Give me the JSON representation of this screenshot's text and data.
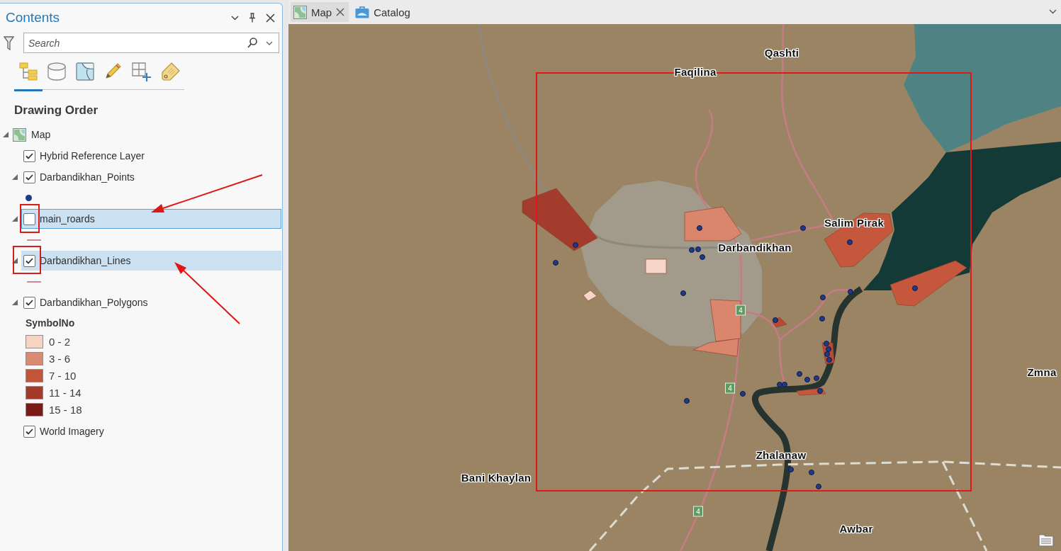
{
  "contents_pane": {
    "title": "Contents",
    "search": {
      "placeholder": "Search"
    },
    "views": [
      {
        "kind": "drawing-order",
        "selected": true
      },
      {
        "kind": "source",
        "selected": false
      },
      {
        "kind": "selection",
        "selected": false
      },
      {
        "kind": "editing",
        "selected": false
      },
      {
        "kind": "snapping",
        "selected": false
      },
      {
        "kind": "labeling",
        "selected": false
      }
    ],
    "heading": "Drawing Order",
    "tree": [
      {
        "label": "Map",
        "kind": "map",
        "expanded": true,
        "children": [
          {
            "label": "Hybrid Reference Layer",
            "checked": true,
            "selected": false,
            "focused": false
          },
          {
            "label": "Darbandikhan_Points",
            "checked": true,
            "selected": false,
            "focused": false,
            "expanded": true,
            "symbol": {
              "kind": "point",
              "color": "#1f3a8a"
            }
          },
          {
            "label": "main_roards",
            "checked": false,
            "selected": true,
            "focused": true,
            "expanded": true,
            "symbol": {
              "kind": "line",
              "color": "#c98a98"
            }
          },
          {
            "label": "Darbandikhan_Lines",
            "checked": true,
            "selected": true,
            "focused": false,
            "expanded": true,
            "symbol": {
              "kind": "line",
              "color": "#c98a98"
            }
          },
          {
            "label": "Darbandikhan_Polygons",
            "checked": true,
            "selected": false,
            "focused": false,
            "expanded": true,
            "legend": {
              "heading": "SymbolNo",
              "classes": [
                {
                  "label": "0 - 2",
                  "color": "#f5d4c4"
                },
                {
                  "label": "3 - 6",
                  "color": "#d98a72"
                },
                {
                  "label": "7 - 10",
                  "color": "#c2563b"
                },
                {
                  "label": "11 - 14",
                  "color": "#a33a2a"
                },
                {
                  "label": "15 - 18",
                  "color": "#7a1c15"
                }
              ]
            }
          },
          {
            "label": "World Imagery",
            "checked": true,
            "selected": false,
            "focused": false
          }
        ]
      }
    ]
  },
  "map_view": {
    "tabs": [
      {
        "label": "Map",
        "kind": "map",
        "selected": true
      },
      {
        "label": "Catalog",
        "kind": "catalog",
        "selected": false
      }
    ],
    "labels": [
      {
        "text": "Qashti",
        "kind": "place"
      },
      {
        "text": "Faqilina",
        "kind": "place"
      },
      {
        "text": "Salim Pirak",
        "kind": "place"
      },
      {
        "text": "Darbandikhan",
        "kind": "place"
      },
      {
        "text": "4",
        "kind": "shield"
      },
      {
        "text": "Zmna",
        "kind": "place"
      },
      {
        "text": "4",
        "kind": "shield"
      },
      {
        "text": "Zhalanaw",
        "kind": "place"
      },
      {
        "text": "Bani Khaylan",
        "kind": "place"
      },
      {
        "text": "4",
        "kind": "shield"
      },
      {
        "text": "Awbar",
        "kind": "place"
      }
    ]
  }
}
